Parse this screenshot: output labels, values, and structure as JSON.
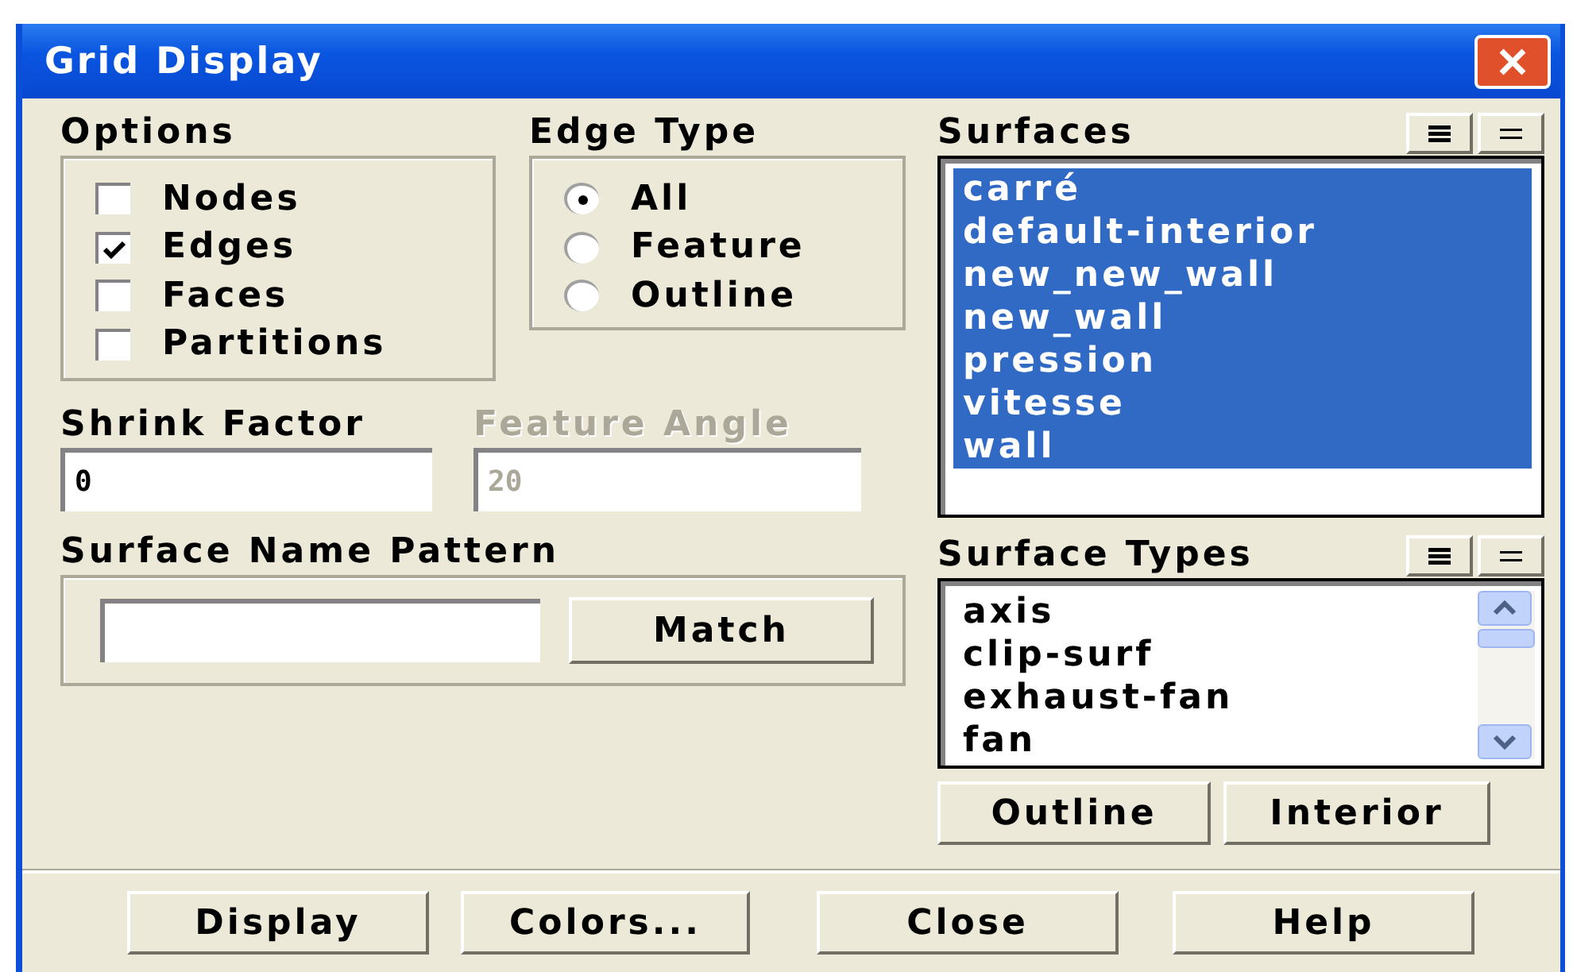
{
  "window": {
    "title": "Grid Display"
  },
  "options": {
    "label": "Options",
    "items": [
      {
        "label": "Nodes",
        "checked": false
      },
      {
        "label": "Edges",
        "checked": true
      },
      {
        "label": "Faces",
        "checked": false
      },
      {
        "label": "Partitions",
        "checked": false
      }
    ]
  },
  "edge_type": {
    "label": "Edge Type",
    "items": [
      {
        "label": "All",
        "selected": true
      },
      {
        "label": "Feature",
        "selected": false
      },
      {
        "label": "Outline",
        "selected": false
      }
    ]
  },
  "shrink_factor": {
    "label": "Shrink Factor",
    "value": "0",
    "disabled": false
  },
  "feature_angle": {
    "label": "Feature Angle",
    "value": "20",
    "disabled": true
  },
  "surface_name_pattern": {
    "label": "Surface Name Pattern",
    "button": "Match"
  },
  "surfaces": {
    "label": "Surfaces",
    "items": [
      {
        "label": "carré",
        "selected": true
      },
      {
        "label": "default-interior",
        "selected": true
      },
      {
        "label": "new_new_wall",
        "selected": true
      },
      {
        "label": "new_wall",
        "selected": true
      },
      {
        "label": "pression",
        "selected": true
      },
      {
        "label": "vitesse",
        "selected": true
      },
      {
        "label": "wall",
        "selected": true
      }
    ]
  },
  "surface_types": {
    "label": "Surface Types",
    "items": [
      {
        "label": "axis",
        "selected": false
      },
      {
        "label": "clip-surf",
        "selected": false
      },
      {
        "label": "exhaust-fan",
        "selected": false
      },
      {
        "label": "fan",
        "selected": false
      }
    ],
    "buttons": [
      "Outline",
      "Interior"
    ]
  },
  "buttons": [
    "Display",
    "Colors...",
    "Close",
    "Help"
  ]
}
